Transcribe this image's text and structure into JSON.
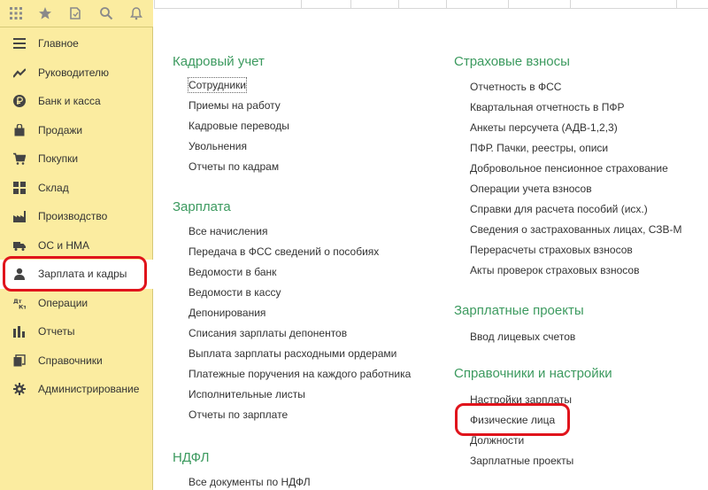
{
  "toolbar": {
    "icons": [
      "apps-grid-icon",
      "star-icon",
      "history-icon",
      "search-icon",
      "bell-icon"
    ]
  },
  "sidebar": {
    "items": [
      {
        "label": "Главное",
        "icon": "list-icon"
      },
      {
        "label": "Руководителю",
        "icon": "trend-icon"
      },
      {
        "label": "Банк и касса",
        "icon": "ruble-icon"
      },
      {
        "label": "Продажи",
        "icon": "bag-icon"
      },
      {
        "label": "Покупки",
        "icon": "cart-icon"
      },
      {
        "label": "Склад",
        "icon": "warehouse-icon"
      },
      {
        "label": "Производство",
        "icon": "factory-icon"
      },
      {
        "label": "ОС и НМА",
        "icon": "truck-icon"
      },
      {
        "label": "Зарплата и кадры",
        "icon": "person-icon",
        "active": true
      },
      {
        "label": "Операции",
        "icon": "dt-kt-icon"
      },
      {
        "label": "Отчеты",
        "icon": "bar-chart-icon"
      },
      {
        "label": "Справочники",
        "icon": "books-icon"
      },
      {
        "label": "Администрирование",
        "icon": "gear-icon"
      }
    ]
  },
  "content": {
    "left": [
      {
        "title": "Кадровый учет",
        "links": [
          "Сотрудники",
          "Приемы на работу",
          "Кадровые переводы",
          "Увольнения",
          "Отчеты по кадрам"
        ]
      },
      {
        "title": "Зарплата",
        "links": [
          "Все начисления",
          "Передача в ФСС сведений о пособиях",
          "Ведомости в банк",
          "Ведомости в кассу",
          "Депонирования",
          "Списания зарплаты депонентов",
          "Выплата зарплаты расходными ордерами",
          "Платежные поручения на каждого работника",
          "Исполнительные листы",
          "Отчеты по зарплате"
        ]
      },
      {
        "title": "НДФЛ",
        "links": [
          "Все документы по НДФЛ"
        ]
      }
    ],
    "right": [
      {
        "title": "Страховые взносы",
        "links": [
          "Отчетность в ФСС",
          "Квартальная отчетность в ПФР",
          "Анкеты персучета (АДВ-1,2,3)",
          "ПФР. Пачки, реестры, описи",
          "Добровольное пенсионное страхование",
          "Операции учета взносов",
          "Справки для расчета пособий (исх.)",
          "Сведения о застрахованных лицах, СЗВ-М",
          "Перерасчеты страховых взносов",
          "Акты проверок страховых взносов"
        ]
      },
      {
        "title": "Зарплатные проекты",
        "links": [
          "Ввод лицевых счетов"
        ]
      },
      {
        "title": "Справочники и настройки",
        "links": [
          "Настройки зарплаты",
          "Физические лица",
          "Должности",
          "Зарплатные проекты"
        ]
      }
    ]
  },
  "colors": {
    "sidebar_bg": "#fbeca0",
    "group_title": "#3c9a5f",
    "highlight": "#e0141c"
  }
}
